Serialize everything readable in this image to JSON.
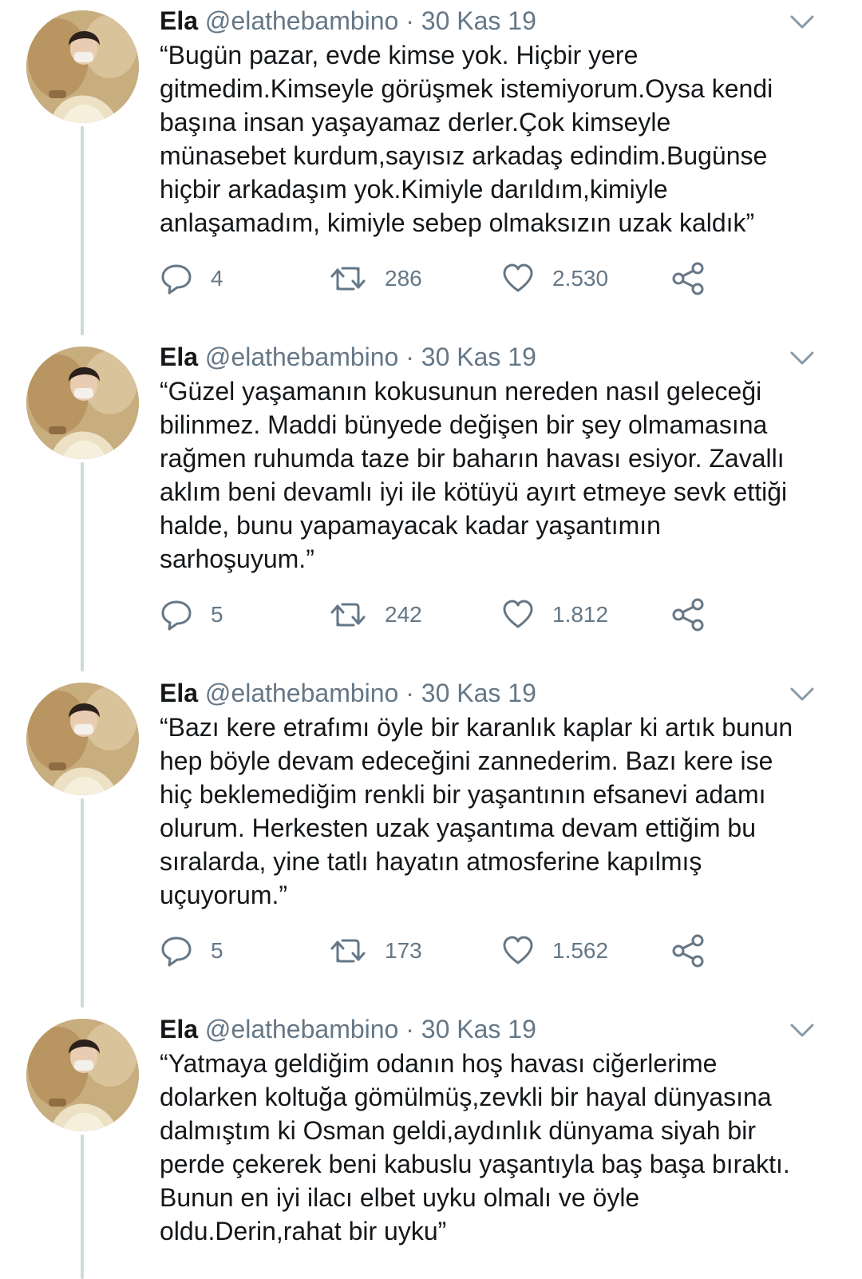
{
  "tweets": [
    {
      "name": "Ela",
      "handle": "@elathebambino",
      "separator": "·",
      "date": "30 Kas 19",
      "text": "“Bugün pazar, evde kimse yok. Hiçbir yere\ngitmedim.Kimseyle görüşmek istemiyorum.Oysa kendi\nbaşına insan yaşayamaz derler.Çok kimseyle\nmünasebet kurdum,sayısız arkadaş edindim.Bugünse\nhiçbir arkadaşım yok.Kimiyle darıldım,kimiyle\nanlaşamadım, kimiyle sebep olmaksızın uzak kaldık”",
      "replies": "4",
      "retweets": "286",
      "likes": "2.530"
    },
    {
      "name": "Ela",
      "handle": "@elathebambino",
      "separator": "·",
      "date": "30 Kas 19",
      "text": "“Güzel yaşamanın kokusunun nereden nasıl geleceği\nbilinmez. Maddi bünyede değişen bir şey olmamasına\nrağmen ruhumda taze bir baharın havası esiyor. Zavallı\naklım beni devamlı iyi ile kötüyü ayırt etmeye sevk ettiği\nhalde, bunu yapamayacak kadar yaşantımın\nsarhoşuyum.”",
      "replies": "5",
      "retweets": "242",
      "likes": "1.812"
    },
    {
      "name": "Ela",
      "handle": "@elathebambino",
      "separator": "·",
      "date": "30 Kas 19",
      "text": "“Bazı kere etrafımı öyle bir karanlık kaplar ki artık bunun\nhep böyle devam edeceğini zannederim. Bazı kere ise\nhiç beklemediğim renkli bir yaşantının efsanevi adamı\nolurum. Herkesten uzak yaşantıma devam ettiğim bu\nsıralarda, yine tatlı hayatın atmosferine kapılmış\nuçuyorum.”",
      "replies": "5",
      "retweets": "173",
      "likes": "1.562"
    },
    {
      "name": "Ela",
      "handle": "@elathebambino",
      "separator": "·",
      "date": "30 Kas 19",
      "text": "“Yatmaya geldiğim odanın hoş havası ciğerlerime\ndolarken koltuğa gömülmüş,zevkli bir hayal dünyasına\ndalmıştım ki Osman geldi,aydınlık dünyama siyah bir\nperde çekerek beni kabuslu yaşantıyla baş başa bıraktı.\nBunun en iyi ilacı elbet uyku olmalı ve öyle\noldu.Derin,rahat bir uyku”",
      "replies": "",
      "retweets": "",
      "likes": ""
    }
  ],
  "icons": {
    "reply": "reply-icon",
    "retweet": "retweet-icon",
    "like": "heart-icon",
    "share": "share-icon",
    "caret": "chevron-down-icon"
  },
  "colors": {
    "text": "#14171a",
    "muted": "#657786",
    "thread_line": "#cfd9de",
    "background": "#ffffff"
  }
}
